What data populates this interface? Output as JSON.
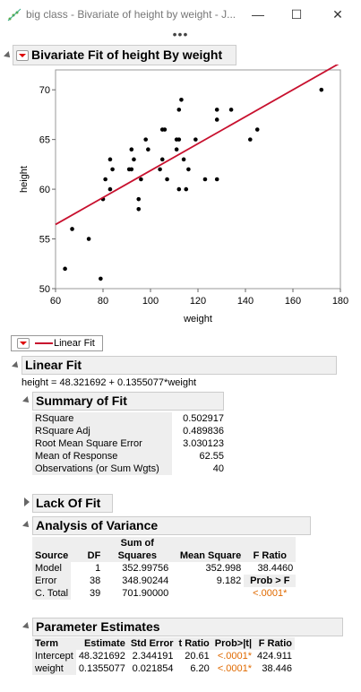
{
  "window": {
    "title": "big class - Bivariate of height by weight - J...",
    "minimize": "—",
    "maximize": "☐",
    "close": "✕",
    "more": "•••"
  },
  "report": {
    "title": "Bivariate Fit of height By weight",
    "legend_label": "Linear Fit",
    "linear_fit_title": "Linear Fit",
    "equation": "height = 48.321692 + 0.1355077*weight"
  },
  "chart_data": {
    "type": "scatter",
    "xlabel": "weight",
    "ylabel": "height",
    "xlim": [
      60,
      180
    ],
    "ylim": [
      50,
      72
    ],
    "xticks": [
      60,
      80,
      100,
      120,
      140,
      160,
      180
    ],
    "yticks": [
      50,
      55,
      60,
      65,
      70
    ],
    "points": [
      [
        64,
        52
      ],
      [
        67,
        56
      ],
      [
        74,
        55
      ],
      [
        79,
        51
      ],
      [
        80,
        59
      ],
      [
        81,
        61
      ],
      [
        83,
        63
      ],
      [
        83,
        60
      ],
      [
        84,
        62
      ],
      [
        91,
        62
      ],
      [
        92,
        64
      ],
      [
        92,
        62
      ],
      [
        93,
        63
      ],
      [
        95,
        59
      ],
      [
        95,
        58
      ],
      [
        96,
        61
      ],
      [
        98,
        65
      ],
      [
        99,
        64
      ],
      [
        104,
        62
      ],
      [
        105,
        63
      ],
      [
        105,
        66
      ],
      [
        106,
        66
      ],
      [
        107,
        61
      ],
      [
        111,
        65
      ],
      [
        111,
        64
      ],
      [
        112,
        65
      ],
      [
        112,
        68
      ],
      [
        112,
        60
      ],
      [
        113,
        69
      ],
      [
        114,
        63
      ],
      [
        115,
        60
      ],
      [
        116,
        62
      ],
      [
        119,
        65
      ],
      [
        123,
        61
      ],
      [
        128,
        61
      ],
      [
        128,
        67
      ],
      [
        128,
        68
      ],
      [
        134,
        68
      ],
      [
        142,
        65
      ],
      [
        145,
        66
      ],
      [
        172,
        70
      ]
    ],
    "fit_line": {
      "name": "Linear Fit",
      "intercept": 48.321692,
      "slope": 0.1355077,
      "color": "#c8102e"
    }
  },
  "summary_of_fit": {
    "title": "Summary of Fit",
    "rows": [
      {
        "label": "RSquare",
        "value": "0.502917"
      },
      {
        "label": "RSquare Adj",
        "value": "0.489836"
      },
      {
        "label": "Root Mean Square Error",
        "value": "3.030123"
      },
      {
        "label": "Mean of Response",
        "value": "62.55"
      },
      {
        "label": "Observations (or Sum Wgts)",
        "value": "40"
      }
    ]
  },
  "lack_of_fit": {
    "title": "Lack Of Fit"
  },
  "anova": {
    "title": "Analysis of Variance",
    "sum_of_label": "Sum of",
    "headers": [
      "Source",
      "DF",
      "Squares",
      "Mean Square",
      "F Ratio"
    ],
    "rows": [
      {
        "source": "Model",
        "df": "1",
        "ss": "352.99756",
        "ms": "352.998",
        "f": "38.4460"
      },
      {
        "source": "Error",
        "df": "38",
        "ss": "348.90244",
        "ms": "9.182",
        "f": "Prob > F"
      },
      {
        "source": "C. Total",
        "df": "39",
        "ss": "701.90000",
        "ms": "",
        "f": "<.0001*"
      }
    ]
  },
  "parameter_estimates": {
    "title": "Parameter Estimates",
    "headers": [
      "Term",
      "Estimate",
      "Std Error",
      "t Ratio",
      "Prob>|t|",
      "F Ratio"
    ],
    "rows": [
      {
        "term": "Intercept",
        "est": "48.321692",
        "se": "2.344191",
        "t": "20.61",
        "p": "<.0001*",
        "f": "424.911"
      },
      {
        "term": "weight",
        "est": "0.1355077",
        "se": "0.021854",
        "t": "6.20",
        "p": "<.0001*",
        "f": "38.446"
      }
    ]
  }
}
